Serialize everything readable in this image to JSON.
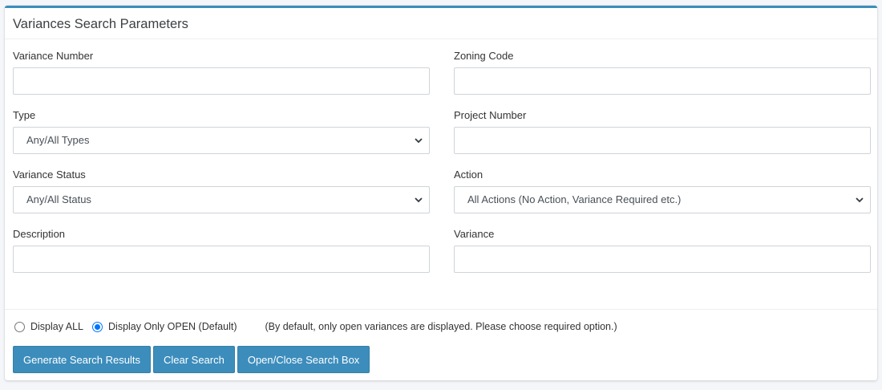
{
  "header": {
    "title": "Variances Search Parameters"
  },
  "fields": {
    "variance_number": {
      "label": "Variance Number",
      "value": ""
    },
    "zoning_code": {
      "label": "Zoning Code",
      "value": ""
    },
    "type": {
      "label": "Type",
      "selected": "Any/All Types"
    },
    "project_number": {
      "label": "Project Number",
      "value": ""
    },
    "variance_status": {
      "label": "Variance Status",
      "selected": "Any/All Status"
    },
    "action": {
      "label": "Action",
      "selected": "All Actions (No Action, Variance Required etc.)"
    },
    "description": {
      "label": "Description",
      "value": ""
    },
    "variance": {
      "label": "Variance",
      "value": ""
    }
  },
  "display_options": {
    "all_label": "Display ALL",
    "open_label": "Display Only OPEN (Default)",
    "selected": "open",
    "note": "(By default, only open variances are displayed. Please choose required option.)"
  },
  "buttons": {
    "generate": "Generate Search Results",
    "clear": "Clear Search",
    "toggle": "Open/Close Search Box"
  },
  "colors": {
    "accent": "#3c8dbc",
    "radio_checked": "#0075ff"
  }
}
